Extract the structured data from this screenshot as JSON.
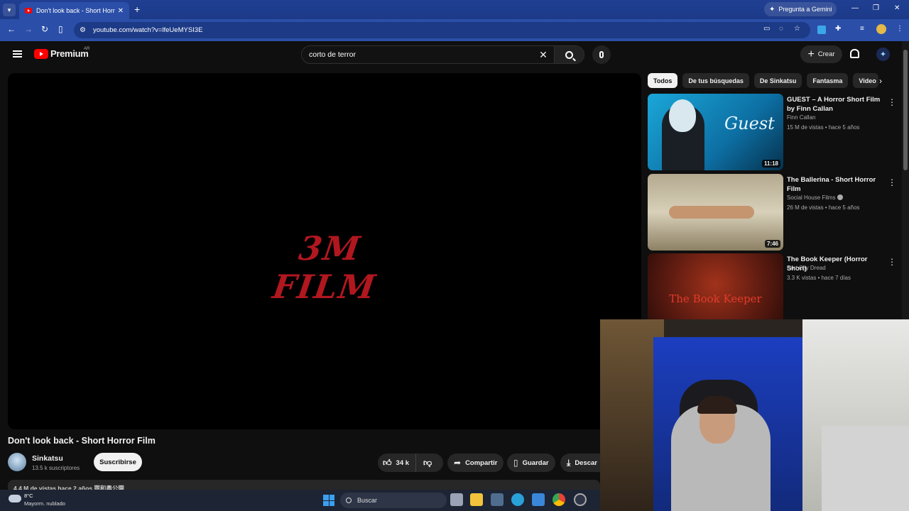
{
  "browser": {
    "tab_title": "Don't look back - Short Horror Film",
    "new_tab": "+",
    "gemini_label": "Pregunta a Gemini",
    "url": "youtube.com/watch?v=lfeUeMYSI3E",
    "window_controls": [
      "—",
      "❐",
      "✕"
    ]
  },
  "youtube": {
    "logo_word": "Premium",
    "logo_country": "AR",
    "search_query": "corto de terror",
    "create_label": "Crear"
  },
  "video": {
    "overlay_text": "3M FILM",
    "title": "Don't look back - Short Horror Film",
    "channel": "Sinkatsu",
    "subscribers": "13.5 k suscriptores",
    "subscribe_label": "Suscribirse",
    "likes": "34 k",
    "share_label": "Compartir",
    "save_label": "Guardar",
    "download_label": "Descar",
    "description_peek": "4.4 M de vistas  hace 2 años  罪和奧公園"
  },
  "chips": [
    "Todos",
    "De tus búsquedas",
    "De Sinkatsu",
    "Fantasma",
    "Video"
  ],
  "recommendations": [
    {
      "title": "GUEST – A Horror Short Film by Finn Callan",
      "channel": "Finn Callan",
      "meta": "15 M de vistas • hace 5 años",
      "duration": "11:18",
      "thumb_text": "Guest"
    },
    {
      "title": "The Ballerina - Short Horror Film",
      "channel": "Social House Films",
      "meta": "26 M de vistas • hace 5 años",
      "duration": "7:46",
      "verified": true
    },
    {
      "title": "The Book Keeper (Horror Short)",
      "channel": "Port City Dread",
      "meta": "3.3 K vistas • hace 7 días",
      "thumb_text": "The Book Keeper"
    }
  ],
  "taskbar": {
    "temperature": "8°C",
    "weather": "Mayorm. nublado",
    "search_label": "Buscar"
  },
  "colors": {
    "accent_red": "#ff0000",
    "brand_text": "#b0171f",
    "chrome_blue": "#2b4fa8"
  }
}
